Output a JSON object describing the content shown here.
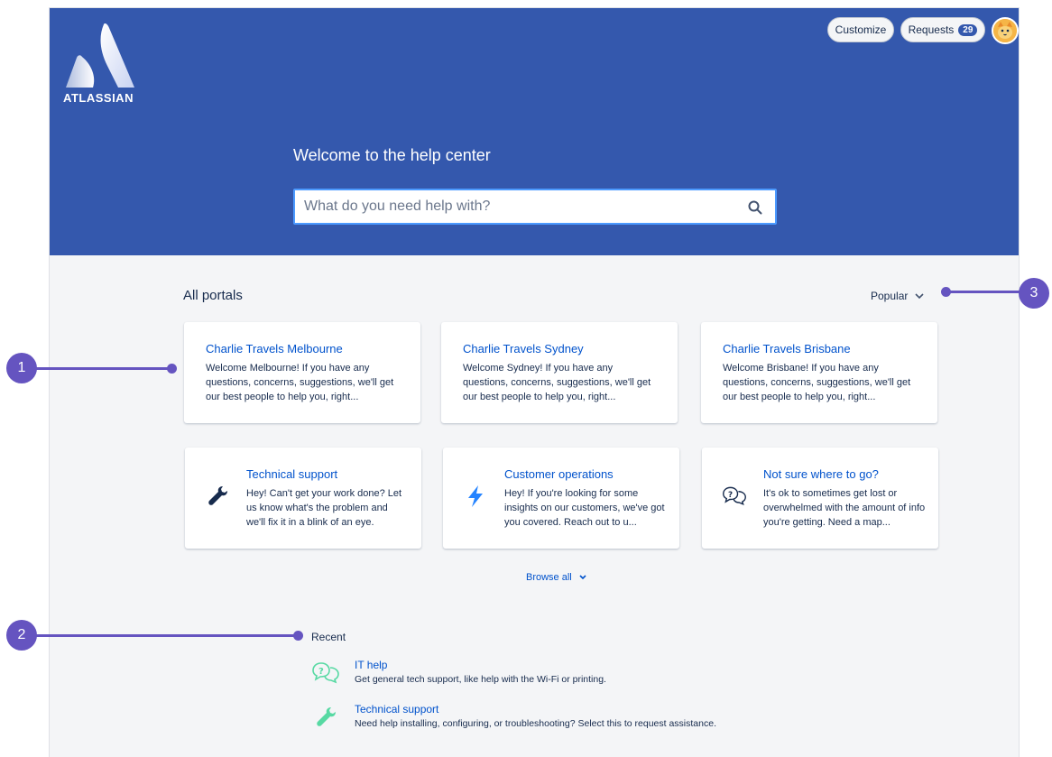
{
  "header": {
    "logo_text": "ATLASSIAN",
    "customize_label": "Customize",
    "requests_label": "Requests",
    "requests_count": "29"
  },
  "hero": {
    "welcome": "Welcome to the help center",
    "search_placeholder": "What do you need help with?"
  },
  "portals": {
    "section_title": "All portals",
    "sort_label": "Popular",
    "cards": [
      {
        "title": "Charlie Travels Melbourne",
        "desc": "Welcome Melbourne! If you have any questions, concerns, suggestions, we'll get our best people to help you, right..."
      },
      {
        "title": "Charlie Travels Sydney",
        "desc": "Welcome Sydney! If you have any questions, concerns, suggestions, we'll get our best people to help you, right..."
      },
      {
        "title": "Charlie Travels Brisbane",
        "desc": "Welcome Brisbane! If you have any questions, concerns, suggestions, we'll get our best people to help you, right..."
      },
      {
        "title": "Technical support",
        "desc": "Hey! Can't get your work done? Let us know what's the problem and we'll fix it in a blink of an eye.",
        "icon": "wrench-icon"
      },
      {
        "title": "Customer operations",
        "desc": "Hey! If you're looking for some insights on our customers, we've got you covered. Reach out to u...",
        "icon": "lightning-icon"
      },
      {
        "title": "Not sure where to go?",
        "desc": "It's ok to sometimes get lost or overwhelmed with the amount of info you're getting. Need a map...",
        "icon": "question-bubble-icon"
      }
    ],
    "browse_all": "Browse all"
  },
  "recent": {
    "title": "Recent",
    "items": [
      {
        "name": "IT help",
        "desc": "Get general tech support, like help with the Wi-Fi or printing.",
        "icon": "question-bubble-icon"
      },
      {
        "name": "Technical support",
        "desc": "Need help installing, configuring, or troubleshooting? Select this to request assistance.",
        "icon": "wrench-icon"
      }
    ]
  },
  "callouts": [
    "1",
    "2",
    "3"
  ],
  "colors": {
    "banner": "#3458ad",
    "link": "#0052cc",
    "callout": "#6554c0",
    "recent_icon": "#57d9a3"
  }
}
